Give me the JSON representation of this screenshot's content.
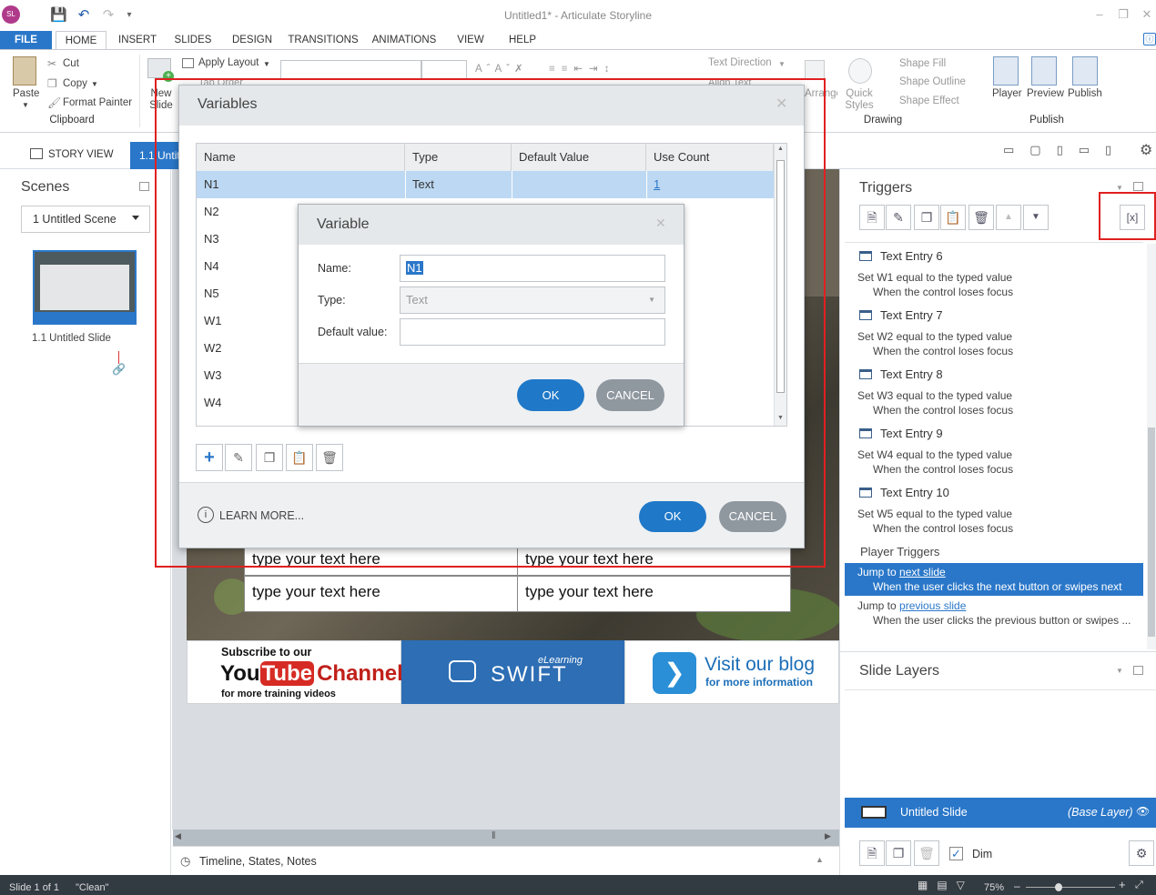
{
  "app": {
    "title": "Untitled1* - Articulate Storyline",
    "avatar": "SL"
  },
  "tabs": [
    "FILE",
    "HOME",
    "INSERT",
    "SLIDES",
    "DESIGN",
    "TRANSITIONS",
    "ANIMATIONS",
    "VIEW",
    "HELP"
  ],
  "ribbon": {
    "paste": "Paste",
    "cut": "Cut",
    "copy": "Copy",
    "format_painter": "Format Painter",
    "clipboard": "Clipboard",
    "new_slide": "New Slide",
    "apply_layout": "Apply Layout",
    "tab_order": "Tab Order",
    "text_direction": "Text Direction",
    "align_text": "Align Text",
    "arrange": "Arrange",
    "quick_styles": "Quick Styles",
    "shape_fill": "Shape Fill",
    "shape_outline": "Shape Outline",
    "shape_effect": "Shape Effect",
    "drawing": "Drawing",
    "player": "Player",
    "preview": "Preview",
    "publish_btn": "Publish",
    "publish_group": "Publish"
  },
  "view": {
    "story_view": "STORY VIEW",
    "slide_tab": "1.1 Untitled Slide"
  },
  "scenes": {
    "title": "Scenes",
    "selected": "1 Untitled Scene",
    "slide_caption": "1.1 Untitled Slide"
  },
  "slide": {
    "cells": [
      "type your text here",
      "type your text here",
      "type your text here",
      "type your text here"
    ],
    "banner1_line1": "Subscribe to our",
    "banner1_you": "You",
    "banner1_tube": "Tube",
    "banner1_channel": "Channel",
    "banner1_line3": "for more training videos",
    "banner2_small": "eLearning",
    "banner2_big": "SWIFT",
    "banner3_big": "Visit our blog",
    "banner3_small": "for more information"
  },
  "timeline": "Timeline, States, Notes",
  "triggers": {
    "title": "Triggers",
    "items": [
      {
        "head": "Text Entry 6",
        "action": "Set W1 equal to the typed value",
        "when": "When the control loses focus"
      },
      {
        "head": "Text Entry 7",
        "action": "Set W2 equal to the typed value",
        "when": "When the control loses focus"
      },
      {
        "head": "Text Entry 8",
        "action": "Set W3 equal to the typed value",
        "when": "When the control loses focus"
      },
      {
        "head": "Text Entry 9",
        "action": "Set W4 equal to the typed value",
        "when": "When the control loses focus"
      },
      {
        "head": "Text Entry 10",
        "action": "Set W5 equal to the typed value",
        "when": "When the control loses focus"
      }
    ],
    "player_triggers": "Player Triggers",
    "jump_to": "Jump to",
    "next_link": "next slide",
    "next_when": "When the user clicks the next button or swipes next",
    "prev_link": "previous slide",
    "prev_when": "When the user clicks the previous button or swipes ..."
  },
  "layers": {
    "title": "Slide Layers",
    "base_name": "Untitled Slide",
    "base_tag": "(Base Layer)",
    "dim": "Dim"
  },
  "status": {
    "slide": "Slide 1 of 1",
    "theme": "\"Clean\"",
    "zoom": "75%"
  },
  "variables": {
    "title": "Variables",
    "columns": [
      "Name",
      "Type",
      "Default Value",
      "Use Count"
    ],
    "rows": [
      {
        "name": "N1",
        "type": "Text",
        "default": "",
        "count": "1"
      },
      {
        "name": "N2"
      },
      {
        "name": "N3"
      },
      {
        "name": "N4"
      },
      {
        "name": "N5"
      },
      {
        "name": "W1"
      },
      {
        "name": "W2"
      },
      {
        "name": "W3"
      },
      {
        "name": "W4"
      }
    ],
    "learn_more": "LEARN MORE...",
    "ok": "OK",
    "cancel": "CANCEL"
  },
  "variable": {
    "title": "Variable",
    "name_label": "Name:",
    "name_value": "N1",
    "type_label": "Type:",
    "type_value": "Text",
    "default_label": "Default value:",
    "default_value": "",
    "ok": "OK",
    "cancel": "CANCEL"
  },
  "colors": {
    "accent": "#2a77c9",
    "highlight": "#e02020",
    "cancel_gray": "#8f979f"
  }
}
